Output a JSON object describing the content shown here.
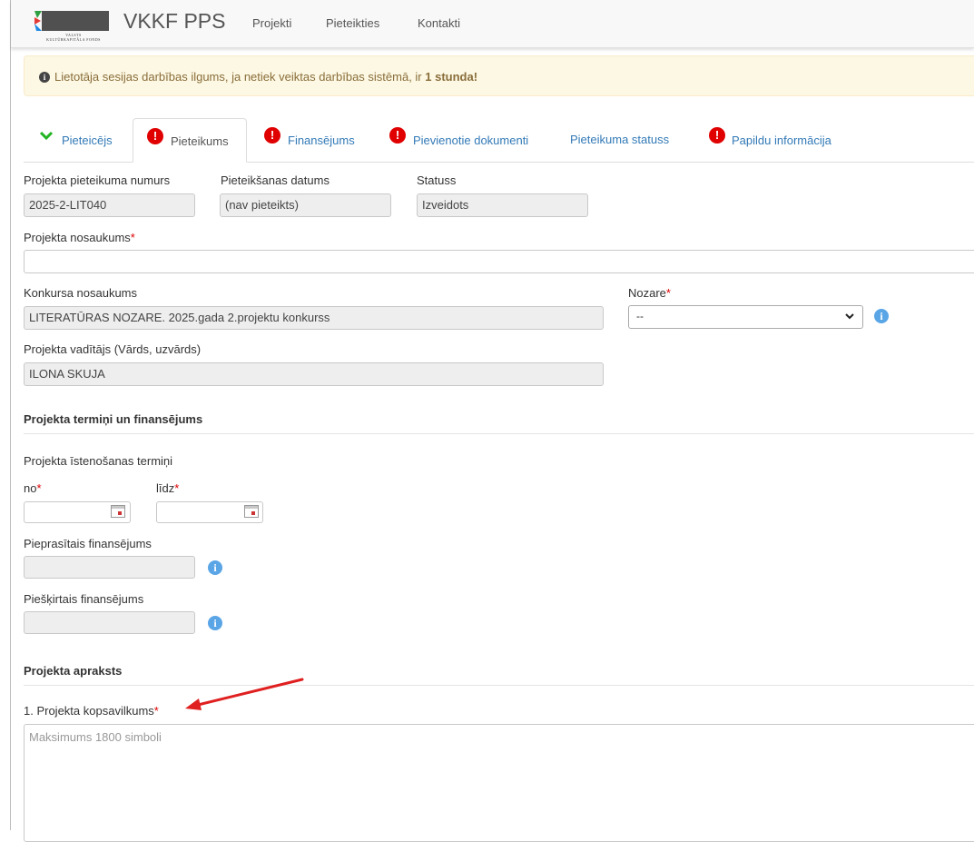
{
  "navbar": {
    "logo_text_line1": "VALSTS",
    "logo_text_line2": "KULTŪRKAPITĀLA FONDS",
    "brand": "VKKF PPS",
    "links": [
      "Projekti",
      "Pieteikties",
      "Kontakti"
    ]
  },
  "alert": {
    "text": "Lietotāja sesijas darbības ilgums, ja netiek veiktas darbības sistēmā, ir ",
    "bold": "1 stunda",
    "suffix": "!"
  },
  "tabs": [
    {
      "label": "Pieteicējs",
      "status": "ok"
    },
    {
      "label": "Pieteikums",
      "status": "error",
      "active": true
    },
    {
      "label": "Finansējums",
      "status": "error"
    },
    {
      "label": "Pievienotie dokumenti",
      "status": "error"
    },
    {
      "label": "Pieteikuma statuss",
      "status": "none"
    },
    {
      "label": "Papildu informācija",
      "status": "error"
    }
  ],
  "form": {
    "project_number_label": "Projekta pieteikuma numurs",
    "project_number_value": "2025-2-LIT040",
    "submission_date_label": "Pieteikšanas datums",
    "submission_date_value": "(nav pieteikts)",
    "status_label": "Statuss",
    "status_value": "Izveidots",
    "project_name_label": "Projekta nosaukums",
    "project_name_value": "",
    "contest_name_label": "Konkursa nosaukums",
    "contest_name_value": "LITERATŪRAS NOZARE. 2025.gada 2.projektu konkurss",
    "sector_label": "Nozare",
    "sector_value": "--",
    "manager_label": "Projekta vadītājs (Vārds, uzvārds)",
    "manager_value": "ILONA SKUJA",
    "required_mark": "*"
  },
  "terms_section": {
    "title": "Projekta termiņi un finansējums",
    "period_label": "Projekta īstenošanas termiņi",
    "from_label": "no",
    "to_label": "līdz",
    "from_value": "",
    "to_value": "",
    "requested_label": "Pieprasītais finansējums",
    "requested_value": "",
    "granted_label": "Piešķirtais finansējums",
    "granted_value": ""
  },
  "description_section": {
    "title": "Projekta apraksts",
    "summary_label": "1. Projekta kopsavilkums",
    "summary_placeholder": "Maksimums 1800 simboli",
    "summary_value": ""
  },
  "colors": {
    "link": "#337ab7",
    "error": "#e00000",
    "ok": "#22b422",
    "alert_bg": "#fcf8e3",
    "alert_text": "#8a6d3b",
    "info": "#5aa5e6",
    "annotation_arrow": "#e02020"
  },
  "icons": {
    "alert": "info-circle-icon",
    "tab_ok": "checkmark-icon",
    "tab_error": "exclamation-circle-icon",
    "field_info": "info-circle-icon",
    "date": "calendar-icon",
    "dropdown": "chevron-down-icon"
  }
}
